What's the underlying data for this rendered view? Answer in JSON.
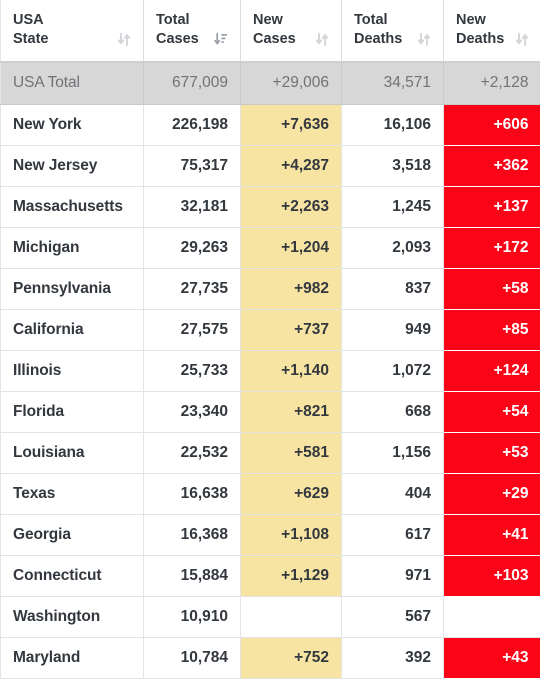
{
  "table": {
    "columns": [
      {
        "id": "state",
        "line1": "USA",
        "line2": "State",
        "sort": "unsorted",
        "align": "left"
      },
      {
        "id": "tcases",
        "line1": "Total",
        "line2": "Cases",
        "sort": "desc",
        "align": "right"
      },
      {
        "id": "ncases",
        "line1": "New",
        "line2": "Cases",
        "sort": "unsorted",
        "align": "right"
      },
      {
        "id": "tdeaths",
        "line1": "Total",
        "line2": "Deaths",
        "sort": "unsorted",
        "align": "right"
      },
      {
        "id": "ndeaths",
        "line1": "New",
        "line2": "Deaths",
        "sort": "unsorted",
        "align": "right"
      }
    ],
    "colors": {
      "new_cases_highlight": "#f7e4a3",
      "new_deaths_highlight": "#fa0418",
      "total_row_background": "#d7d7d7",
      "text": "#32383e"
    },
    "total_row": {
      "state": "USA Total",
      "total_cases": "677,009",
      "new_cases": "+29,006",
      "total_deaths": "34,571",
      "new_deaths": "+2,128"
    },
    "rows": [
      {
        "state": "New York",
        "total_cases": "226,198",
        "new_cases": "+7,636",
        "total_deaths": "16,106",
        "new_deaths": "+606"
      },
      {
        "state": "New Jersey",
        "total_cases": "75,317",
        "new_cases": "+4,287",
        "total_deaths": "3,518",
        "new_deaths": "+362"
      },
      {
        "state": "Massachusetts",
        "total_cases": "32,181",
        "new_cases": "+2,263",
        "total_deaths": "1,245",
        "new_deaths": "+137"
      },
      {
        "state": "Michigan",
        "total_cases": "29,263",
        "new_cases": "+1,204",
        "total_deaths": "2,093",
        "new_deaths": "+172"
      },
      {
        "state": "Pennsylvania",
        "total_cases": "27,735",
        "new_cases": "+982",
        "total_deaths": "837",
        "new_deaths": "+58"
      },
      {
        "state": "California",
        "total_cases": "27,575",
        "new_cases": "+737",
        "total_deaths": "949",
        "new_deaths": "+85"
      },
      {
        "state": "Illinois",
        "total_cases": "25,733",
        "new_cases": "+1,140",
        "total_deaths": "1,072",
        "new_deaths": "+124"
      },
      {
        "state": "Florida",
        "total_cases": "23,340",
        "new_cases": "+821",
        "total_deaths": "668",
        "new_deaths": "+54"
      },
      {
        "state": "Louisiana",
        "total_cases": "22,532",
        "new_cases": "+581",
        "total_deaths": "1,156",
        "new_deaths": "+53"
      },
      {
        "state": "Texas",
        "total_cases": "16,638",
        "new_cases": "+629",
        "total_deaths": "404",
        "new_deaths": "+29"
      },
      {
        "state": "Georgia",
        "total_cases": "16,368",
        "new_cases": "+1,108",
        "total_deaths": "617",
        "new_deaths": "+41"
      },
      {
        "state": "Connecticut",
        "total_cases": "15,884",
        "new_cases": "+1,129",
        "total_deaths": "971",
        "new_deaths": "+103"
      },
      {
        "state": "Washington",
        "total_cases": "10,910",
        "new_cases": "",
        "total_deaths": "567",
        "new_deaths": ""
      },
      {
        "state": "Maryland",
        "total_cases": "10,784",
        "new_cases": "+752",
        "total_deaths": "392",
        "new_deaths": "+43"
      }
    ]
  }
}
